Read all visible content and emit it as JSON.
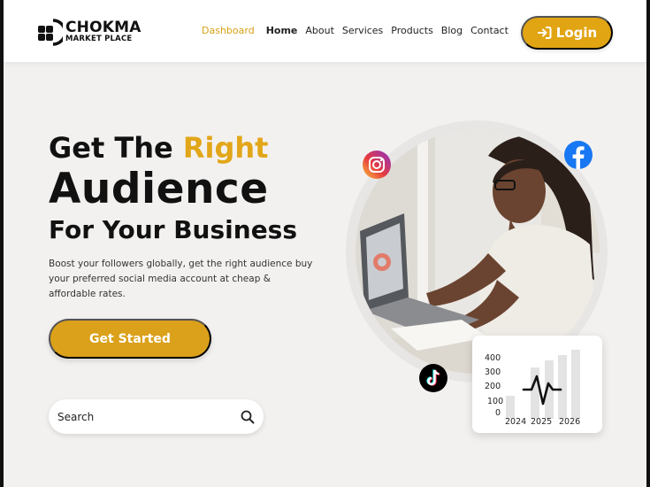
{
  "brand": {
    "name": "CHOKMA",
    "tagline": "MARKET PLACE"
  },
  "nav": {
    "items": [
      {
        "label": "Dashboard",
        "active": true
      },
      {
        "label": "Home",
        "active": false,
        "bold": true
      },
      {
        "label": "About",
        "active": false
      },
      {
        "label": "Services",
        "active": false
      },
      {
        "label": "Products",
        "active": false
      },
      {
        "label": "Blog",
        "active": false
      },
      {
        "label": "Contact",
        "active": false
      }
    ],
    "login_label": "Login",
    "login_icon": "login-arrow-icon"
  },
  "hero": {
    "line1_prefix": "Get The",
    "line1_accent": "Right",
    "line2": "Audience",
    "line3": "For Your Business",
    "description": "Boost your followers globally, get the right  audience buy your preferred social media account at cheap & affordable rates.",
    "cta_label": "Get Started"
  },
  "search": {
    "placeholder": "Search",
    "icon": "search-icon"
  },
  "social_icons": [
    "instagram-icon",
    "facebook-icon",
    "tiktok-icon"
  ],
  "stats_card": {
    "y_ticks": [
      "400",
      "300",
      "200",
      "100",
      "0"
    ],
    "x_ticks": [
      "2024",
      "2025",
      "2026"
    ]
  },
  "colors": {
    "accent": "#e1a413",
    "background": "#f3f1ef",
    "text": "#111111"
  }
}
